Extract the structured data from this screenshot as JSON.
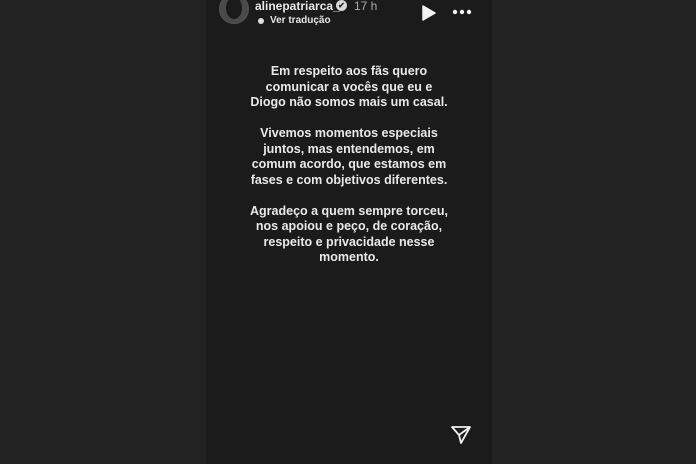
{
  "header": {
    "username": "alinepatriarca_",
    "verified_symbol": "✔",
    "time": "17 h",
    "translate_label": "Ver tradução",
    "icons": [
      "avatar",
      "verified-badge-icon",
      "play-icon",
      "more-icon"
    ]
  },
  "story": {
    "paragraphs": [
      "Em respeito aos fãs quero comunicar a vocês que eu e Diogo não somos mais um casal.",
      "Vivemos momentos especiais juntos, mas entendemos, em comum acordo, que estamos em fases e com objetivos diferentes.",
      "Agradeço a quem sempre torceu, nos apoiou e peço, de coração, respeito e privacidade nesse momento."
    ]
  },
  "footer": {
    "icons": [
      "send-icon"
    ]
  },
  "colors": {
    "background": "#232323",
    "story_background": "#1b1b1b",
    "text": "#e9e9e9"
  }
}
